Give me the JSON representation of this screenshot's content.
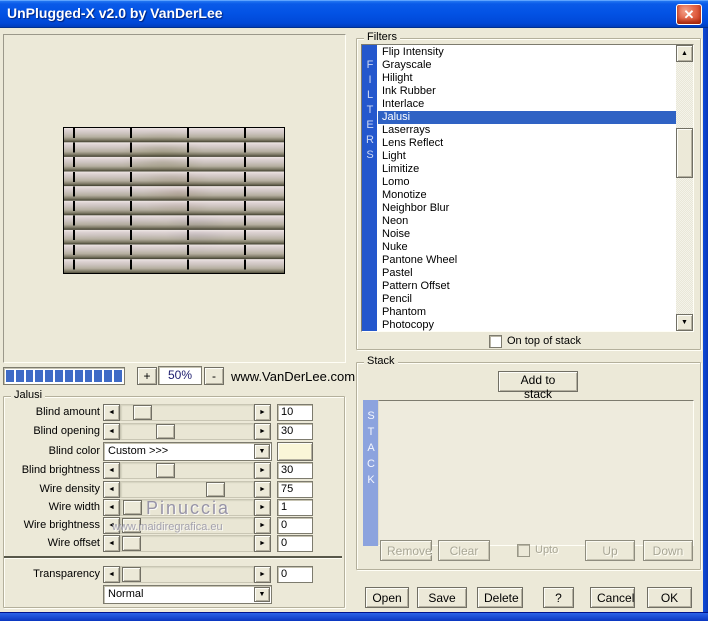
{
  "window": {
    "title": "UnPlugged-X v2.0 by VanDerLee",
    "close_glyph": "✕"
  },
  "colors": {
    "dialog_bg": "#ece9d8",
    "titlebar_blue": "#0353e5",
    "selection_blue": "#2f62c4",
    "filters_bar_blue": "#2457cd",
    "stack_bar_blue": "#8ca3de",
    "progress_block_blue": "#3f6bc6",
    "swatch_cream": "#faf6d8",
    "close_red": "#d8452b"
  },
  "preview": {
    "zoom_in_label": "+",
    "zoom_out_label": "-",
    "zoom_level": "50%",
    "website": "www.VanDerLee.com",
    "progress_blocks": 12
  },
  "filters_panel": {
    "group_label": "Filters",
    "vertical_label": "FILTERS",
    "selected_item": "Jalusi",
    "selected_index": 5,
    "items": [
      "Flip Intensity",
      "Grayscale",
      "Hilight",
      "Ink Rubber",
      "Interlace",
      "Jalusi",
      "Laserrays",
      "Lens Reflect",
      "Light",
      "Limitize",
      "Lomo",
      "Monotize",
      "Neighbor Blur",
      "Neon",
      "Noise",
      "Nuke",
      "Pantone Wheel",
      "Pastel",
      "Pattern Offset",
      "Pencil",
      "Phantom",
      "Photocopy"
    ],
    "on_top_label": "On top of stack",
    "on_top_checked": false,
    "scroll_up_glyph": "▲",
    "scroll_down_glyph": "▼"
  },
  "jalusi": {
    "group_label": "Jalusi",
    "left_arrow_glyph": "◄",
    "right_arrow_glyph": "►",
    "dropdown_arrow_glyph": "▼",
    "sliders": [
      {
        "label": "Blind amount",
        "value": 10
      },
      {
        "label": "Blind opening",
        "value": 30
      },
      {
        "label": "Blind brightness",
        "value": 30
      },
      {
        "label": "Wire density",
        "value": 75
      },
      {
        "label": "Wire width",
        "value": 1
      },
      {
        "label": "Wire brightness",
        "value": 0
      },
      {
        "label": "Wire offset",
        "value": 0
      }
    ],
    "blind_color": {
      "label": "Blind color",
      "value": "Custom >>>",
      "swatch_hex": "#faf6d8"
    },
    "transparency": {
      "label": "Transparency",
      "value": 0
    },
    "blend_mode": "Normal"
  },
  "stack_panel": {
    "group_label": "Stack",
    "vertical_label": "STACK",
    "add_button": "Add to stack",
    "remove_button": "Remove",
    "clear_button": "Clear",
    "upto_label": "Upto",
    "upto_checked": false,
    "up_button": "Up",
    "down_button": "Down"
  },
  "footer": {
    "open": "Open",
    "save": "Save",
    "delete": "Delete",
    "help": "?",
    "cancel": "Cancel",
    "ok": "OK"
  },
  "watermark": {
    "name": "Pinuccia",
    "url": "www.maidiregrafica.eu"
  }
}
